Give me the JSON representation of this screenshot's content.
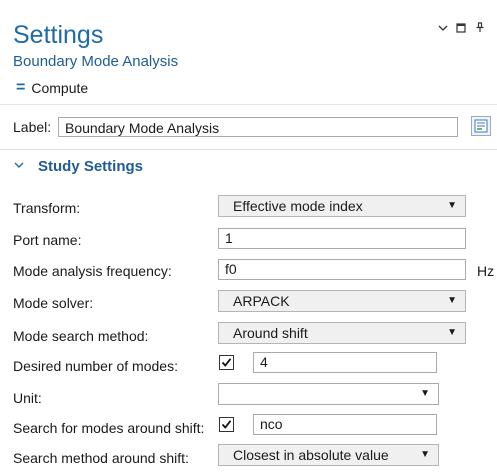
{
  "header": {
    "title": "Settings",
    "subtitle": "Boundary Mode Analysis",
    "compute_label": "Compute"
  },
  "label_row": {
    "label": "Label:",
    "value": "Boundary Mode Analysis"
  },
  "section": {
    "title": "Study Settings"
  },
  "rows": {
    "transform": {
      "label": "Transform:",
      "value": "Effective mode index"
    },
    "port_name": {
      "label": "Port name:",
      "value": "1"
    },
    "mode_freq": {
      "label": "Mode analysis frequency:",
      "value": "f0",
      "unit": "Hz"
    },
    "mode_solver": {
      "label": "Mode solver:",
      "value": "ARPACK"
    },
    "search_method": {
      "label": "Mode search method:",
      "value": "Around shift"
    },
    "desired_modes": {
      "label": "Desired number of modes:",
      "value": "4",
      "checked": true
    },
    "unit": {
      "label": "Unit:",
      "value": ""
    },
    "search_shift": {
      "label": "Search for modes around shift:",
      "value": "nco",
      "checked": true
    },
    "search_method_shift": {
      "label": "Search method around shift:",
      "value": "Closest in absolute value"
    }
  },
  "colors": {
    "accent": "#1f6aa8",
    "heading": "#1f5c93"
  },
  "icons": [
    "chevron-down-icon",
    "restore-window-icon",
    "pin-icon",
    "equals-icon",
    "edit-label-icon",
    "dropdown-arrow-icon",
    "checkmark-icon"
  ]
}
